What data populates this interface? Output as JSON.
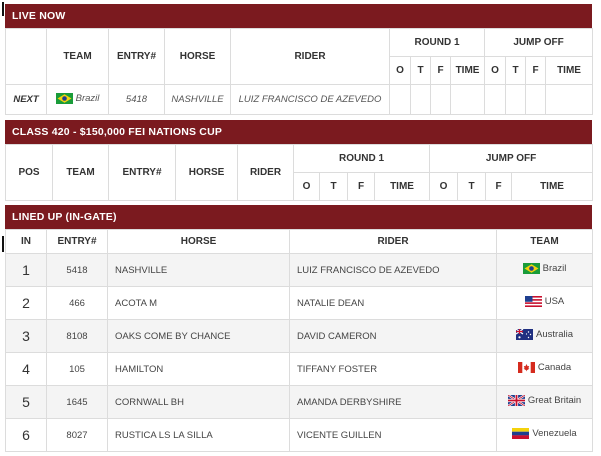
{
  "live_now": {
    "title": "LIVE NOW",
    "headers": {
      "team": "TEAM",
      "entry": "ENTRY#",
      "horse": "HORSE",
      "rider": "RIDER",
      "round1": "ROUND 1",
      "jumpoff": "JUMP OFF",
      "sub": [
        "O",
        "T",
        "F",
        "TIME",
        "O",
        "T",
        "F",
        "TIME"
      ]
    },
    "row": {
      "label": "NEXT",
      "team": "Brazil",
      "entry": "5418",
      "horse": "NASHVILLE",
      "rider": "LUIZ FRANCISCO DE AZEVEDO"
    }
  },
  "class420": {
    "title": "CLASS 420 - $150,000 FEI NATIONS CUP",
    "headers": {
      "pos": "POS",
      "team": "TEAM",
      "entry": "ENTRY#",
      "horse": "HORSE",
      "rider": "RIDER",
      "round1": "ROUND 1",
      "jumpoff": "JUMP OFF",
      "sub": [
        "O",
        "T",
        "F",
        "TIME",
        "O",
        "T",
        "F",
        "TIME"
      ]
    }
  },
  "lined_up": {
    "title": "LINED UP (IN-GATE)",
    "headers": {
      "in": "IN",
      "entry": "ENTRY#",
      "horse": "HORSE",
      "rider": "RIDER",
      "team": "TEAM"
    },
    "rows": [
      {
        "in": "1",
        "entry": "5418",
        "horse": "NASHVILLE",
        "rider": "LUIZ FRANCISCO DE AZEVEDO",
        "team": "Brazil",
        "flag": "brazil"
      },
      {
        "in": "2",
        "entry": "466",
        "horse": "ACOTA M",
        "rider": "NATALIE DEAN",
        "team": "USA",
        "flag": "usa"
      },
      {
        "in": "3",
        "entry": "8108",
        "horse": "OAKS COME BY CHANCE",
        "rider": "DAVID CAMERON",
        "team": "Australia",
        "flag": "australia"
      },
      {
        "in": "4",
        "entry": "105",
        "horse": "HAMILTON",
        "rider": "TIFFANY FOSTER",
        "team": "Canada",
        "flag": "canada"
      },
      {
        "in": "5",
        "entry": "1645",
        "horse": "CORNWALL BH",
        "rider": "AMANDA DERBYSHIRE",
        "team": "Great Britain",
        "flag": "great-britain"
      },
      {
        "in": "6",
        "entry": "8027",
        "horse": "RUSTICA LS LA SILLA",
        "rider": "VICENTE GUILLEN",
        "team": "Venezuela",
        "flag": "venezuela"
      }
    ]
  },
  "colors": {
    "header_bg": "#7b1a1f",
    "header_text": "#ffffff",
    "row_alt": "#f4f4f4",
    "border": "#dcdcdc"
  }
}
